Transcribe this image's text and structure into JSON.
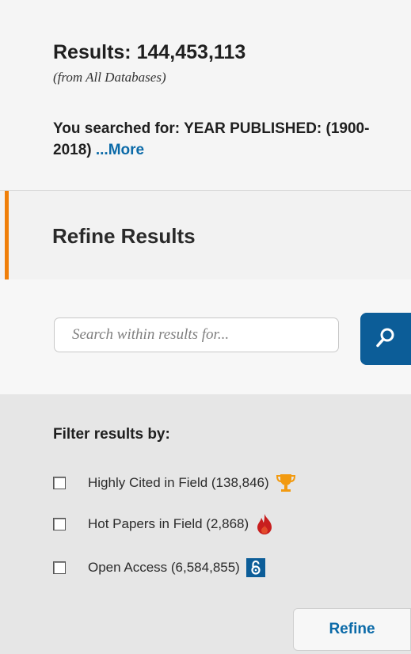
{
  "summary": {
    "results_label": "Results: 144,453,113",
    "source_label": "(from All Databases)",
    "searched_prefix": "You searched for: YEAR PUBLISHED: (1900-2018) ",
    "more_link": "...More"
  },
  "refine": {
    "title": "Refine Results",
    "accent_color": "#f07f09"
  },
  "search": {
    "placeholder": "Search within results for...",
    "value": ""
  },
  "filters": {
    "title": "Filter results by:",
    "items": [
      {
        "label": "Highly Cited in Field (138,846)",
        "icon": "trophy-icon",
        "checked": false
      },
      {
        "label": "Hot Papers in Field (2,868)",
        "icon": "flame-icon",
        "checked": false
      },
      {
        "label": "Open Access (6,584,855)",
        "icon": "open-access-icon",
        "checked": false
      }
    ],
    "refine_button": "Refine"
  },
  "colors": {
    "link": "#0b6aa8",
    "search_button": "#0c5d98",
    "trophy": "#f29a10",
    "flame": "#c81e1e",
    "open_access": "#0c5d98"
  }
}
